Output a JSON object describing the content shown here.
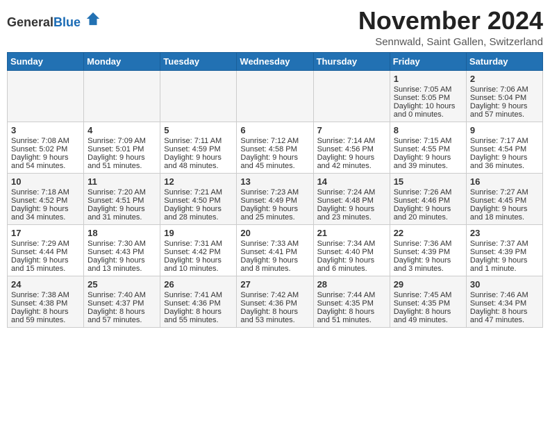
{
  "header": {
    "logo_general": "General",
    "logo_blue": "Blue",
    "month_title": "November 2024",
    "location": "Sennwald, Saint Gallen, Switzerland"
  },
  "weekdays": [
    "Sunday",
    "Monday",
    "Tuesday",
    "Wednesday",
    "Thursday",
    "Friday",
    "Saturday"
  ],
  "weeks": [
    [
      {
        "day": "",
        "content": ""
      },
      {
        "day": "",
        "content": ""
      },
      {
        "day": "",
        "content": ""
      },
      {
        "day": "",
        "content": ""
      },
      {
        "day": "",
        "content": ""
      },
      {
        "day": "1",
        "content": "Sunrise: 7:05 AM\nSunset: 5:05 PM\nDaylight: 10 hours\nand 0 minutes."
      },
      {
        "day": "2",
        "content": "Sunrise: 7:06 AM\nSunset: 5:04 PM\nDaylight: 9 hours\nand 57 minutes."
      }
    ],
    [
      {
        "day": "3",
        "content": "Sunrise: 7:08 AM\nSunset: 5:02 PM\nDaylight: 9 hours\nand 54 minutes."
      },
      {
        "day": "4",
        "content": "Sunrise: 7:09 AM\nSunset: 5:01 PM\nDaylight: 9 hours\nand 51 minutes."
      },
      {
        "day": "5",
        "content": "Sunrise: 7:11 AM\nSunset: 4:59 PM\nDaylight: 9 hours\nand 48 minutes."
      },
      {
        "day": "6",
        "content": "Sunrise: 7:12 AM\nSunset: 4:58 PM\nDaylight: 9 hours\nand 45 minutes."
      },
      {
        "day": "7",
        "content": "Sunrise: 7:14 AM\nSunset: 4:56 PM\nDaylight: 9 hours\nand 42 minutes."
      },
      {
        "day": "8",
        "content": "Sunrise: 7:15 AM\nSunset: 4:55 PM\nDaylight: 9 hours\nand 39 minutes."
      },
      {
        "day": "9",
        "content": "Sunrise: 7:17 AM\nSunset: 4:54 PM\nDaylight: 9 hours\nand 36 minutes."
      }
    ],
    [
      {
        "day": "10",
        "content": "Sunrise: 7:18 AM\nSunset: 4:52 PM\nDaylight: 9 hours\nand 34 minutes."
      },
      {
        "day": "11",
        "content": "Sunrise: 7:20 AM\nSunset: 4:51 PM\nDaylight: 9 hours\nand 31 minutes."
      },
      {
        "day": "12",
        "content": "Sunrise: 7:21 AM\nSunset: 4:50 PM\nDaylight: 9 hours\nand 28 minutes."
      },
      {
        "day": "13",
        "content": "Sunrise: 7:23 AM\nSunset: 4:49 PM\nDaylight: 9 hours\nand 25 minutes."
      },
      {
        "day": "14",
        "content": "Sunrise: 7:24 AM\nSunset: 4:48 PM\nDaylight: 9 hours\nand 23 minutes."
      },
      {
        "day": "15",
        "content": "Sunrise: 7:26 AM\nSunset: 4:46 PM\nDaylight: 9 hours\nand 20 minutes."
      },
      {
        "day": "16",
        "content": "Sunrise: 7:27 AM\nSunset: 4:45 PM\nDaylight: 9 hours\nand 18 minutes."
      }
    ],
    [
      {
        "day": "17",
        "content": "Sunrise: 7:29 AM\nSunset: 4:44 PM\nDaylight: 9 hours\nand 15 minutes."
      },
      {
        "day": "18",
        "content": "Sunrise: 7:30 AM\nSunset: 4:43 PM\nDaylight: 9 hours\nand 13 minutes."
      },
      {
        "day": "19",
        "content": "Sunrise: 7:31 AM\nSunset: 4:42 PM\nDaylight: 9 hours\nand 10 minutes."
      },
      {
        "day": "20",
        "content": "Sunrise: 7:33 AM\nSunset: 4:41 PM\nDaylight: 9 hours\nand 8 minutes."
      },
      {
        "day": "21",
        "content": "Sunrise: 7:34 AM\nSunset: 4:40 PM\nDaylight: 9 hours\nand 6 minutes."
      },
      {
        "day": "22",
        "content": "Sunrise: 7:36 AM\nSunset: 4:39 PM\nDaylight: 9 hours\nand 3 minutes."
      },
      {
        "day": "23",
        "content": "Sunrise: 7:37 AM\nSunset: 4:39 PM\nDaylight: 9 hours\nand 1 minute."
      }
    ],
    [
      {
        "day": "24",
        "content": "Sunrise: 7:38 AM\nSunset: 4:38 PM\nDaylight: 8 hours\nand 59 minutes."
      },
      {
        "day": "25",
        "content": "Sunrise: 7:40 AM\nSunset: 4:37 PM\nDaylight: 8 hours\nand 57 minutes."
      },
      {
        "day": "26",
        "content": "Sunrise: 7:41 AM\nSunset: 4:36 PM\nDaylight: 8 hours\nand 55 minutes."
      },
      {
        "day": "27",
        "content": "Sunrise: 7:42 AM\nSunset: 4:36 PM\nDaylight: 8 hours\nand 53 minutes."
      },
      {
        "day": "28",
        "content": "Sunrise: 7:44 AM\nSunset: 4:35 PM\nDaylight: 8 hours\nand 51 minutes."
      },
      {
        "day": "29",
        "content": "Sunrise: 7:45 AM\nSunset: 4:35 PM\nDaylight: 8 hours\nand 49 minutes."
      },
      {
        "day": "30",
        "content": "Sunrise: 7:46 AM\nSunset: 4:34 PM\nDaylight: 8 hours\nand 47 minutes."
      }
    ]
  ]
}
